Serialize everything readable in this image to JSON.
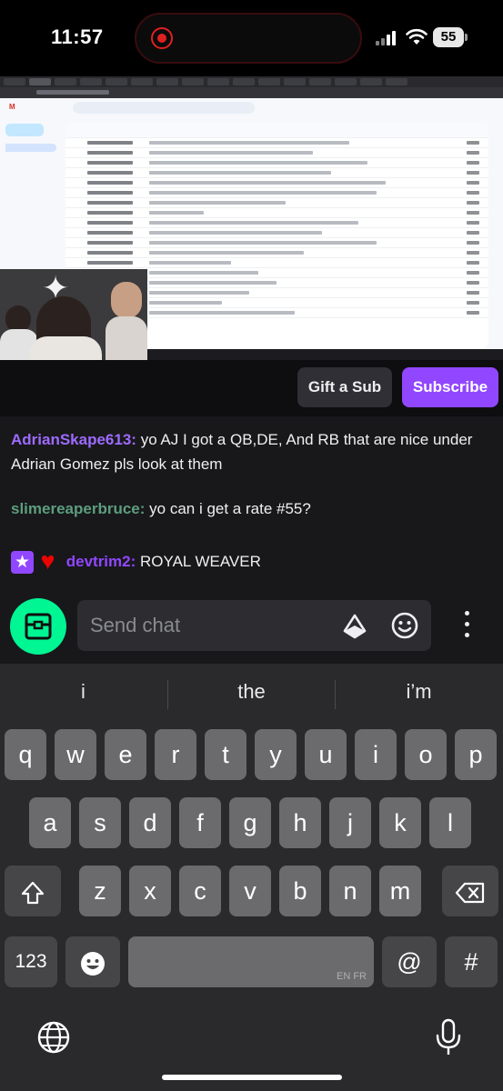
{
  "status_bar": {
    "time": "11:57",
    "battery": "55"
  },
  "stream": {
    "gift_label": "Gift a Sub",
    "subscribe_label": "Subscribe"
  },
  "chat": {
    "messages": [
      {
        "user": "AdrianSkape613:",
        "user_color": "#9e6bff",
        "text": "yo AJ I got a QB,DE, And RB that are nice under Adrian  Gomez pls look at them"
      },
      {
        "user": "slimereaperbruce:",
        "user_color": "#5c9e7e",
        "text": "yo can i get a rate #55?"
      },
      {
        "user": "devtrim2:",
        "user_color": "#9147ff",
        "text": "ROYAL WEAVER",
        "badges": [
          "star-badge",
          "heart-badge"
        ]
      }
    ],
    "input_placeholder": "Send chat"
  },
  "keyboard": {
    "suggestions": [
      "i",
      "the",
      "i’m"
    ],
    "row1": [
      "q",
      "w",
      "e",
      "r",
      "t",
      "y",
      "u",
      "i",
      "o",
      "p"
    ],
    "row2": [
      "a",
      "s",
      "d",
      "f",
      "g",
      "h",
      "j",
      "k",
      "l"
    ],
    "row3": [
      "z",
      "x",
      "c",
      "v",
      "b",
      "n",
      "m"
    ],
    "numbers_key": "123",
    "at_key": "@",
    "hash_key": "#",
    "space_lang": "EN FR"
  },
  "colors": {
    "accent_purple": "#9147ff",
    "chest_green": "#00f593"
  }
}
